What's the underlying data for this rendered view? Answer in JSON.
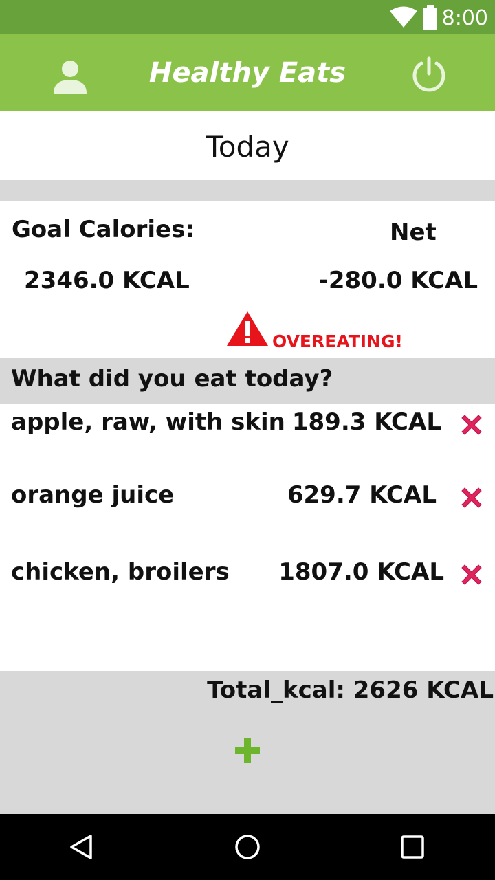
{
  "status_bar": {
    "time": "8:00",
    "icons": [
      "wifi-icon",
      "battery-icon"
    ]
  },
  "app_bar": {
    "title": "Healthy Eats",
    "left_icon": "profile-icon",
    "right_icon": "power-icon",
    "color": "#8bc34a"
  },
  "date_header": "Today",
  "summary": {
    "goal_label": "Goal Calories:",
    "goal_value": "2346.0 KCAL",
    "net_label": "Net",
    "net_value": "-280.0 KCAL",
    "warning_text": "OVEREATING!",
    "warning_icon": "warning-icon",
    "warning_color": "#e8141b"
  },
  "question": "What did you eat today?",
  "foods": [
    {
      "name": "apple, raw, with skin",
      "kcal": "189.3 KCAL"
    },
    {
      "name": "orange juice",
      "kcal": "629.7 KCAL"
    },
    {
      "name": "chicken, broilers",
      "kcal": "1807.0 KCAL"
    }
  ],
  "total": "Total_kcal: 2626 KCAL",
  "add_icon": "plus-icon",
  "nav_bar": [
    "back-icon",
    "home-icon",
    "recents-icon"
  ]
}
